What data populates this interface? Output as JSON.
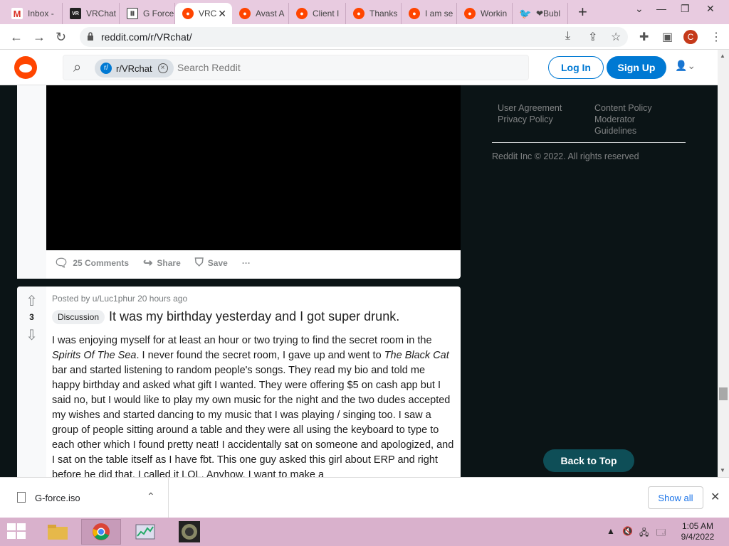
{
  "tabs": [
    {
      "label": "Inbox -",
      "icon": "gmail-icon"
    },
    {
      "label": "VRChat",
      "icon": "vrchat-icon"
    },
    {
      "label": "G Force",
      "icon": "gforce-icon"
    },
    {
      "label": "VRC",
      "icon": "reddit-icon",
      "active": true
    },
    {
      "label": "Avast A",
      "icon": "reddit-icon"
    },
    {
      "label": "Client I",
      "icon": "reddit-icon"
    },
    {
      "label": "Thanks",
      "icon": "reddit-icon"
    },
    {
      "label": "I am se",
      "icon": "reddit-icon"
    },
    {
      "label": "Workin",
      "icon": "reddit-icon"
    },
    {
      "label": "❤Bubl",
      "icon": "twitter-icon"
    }
  ],
  "address_bar": {
    "url": "reddit.com/r/VRchat/",
    "profile_initial": "C"
  },
  "reddit_header": {
    "community_chip": "r/VRchat",
    "search_placeholder": "Search Reddit",
    "login_label": "Log In",
    "signup_label": "Sign Up"
  },
  "post1": {
    "comments_label": "25 Comments",
    "share_label": "Share",
    "save_label": "Save",
    "more_label": "···"
  },
  "post2": {
    "vote_count": "3",
    "posted_by": "Posted by u/Luc1phur 20 hours ago",
    "flair": "Discussion",
    "title": "It was my birthday yesterday and I got super drunk.",
    "body_1": "I was enjoying myself for at least an hour or two trying to find the secret room in the ",
    "body_italic_1": "Spirits Of The Sea",
    "body_2": ". I never found the secret room, I gave up and went to ",
    "body_italic_2": "The Black Cat",
    "body_3": " bar and started listening to random people's songs. They read my bio and told me happy birthday and asked what gift I wanted. They were offering $5 on cash app but I said no, but I would like to play my own music for the night and the two dudes accepted my wishes and started dancing to my music that I was playing / singing too. I saw a group of people sitting around a table and they were all using the keyboard to type to each other which I found pretty neat! I accidentally sat on someone and apologized, and I sat on the table itself as I have fbt. This one guy asked this girl about ERP and right before he did that, I called it LOL. Anyhow, I want to make a"
  },
  "sidebar": {
    "links_col1": [
      "User Agreement",
      "Privacy Policy"
    ],
    "links_col2": [
      "Content Policy",
      "Moderator",
      "Guidelines"
    ],
    "copyright": "Reddit Inc © 2022. All rights reserved",
    "back_to_top": "Back to Top"
  },
  "downloads": {
    "file_name": "G-force.iso",
    "show_all": "Show all"
  },
  "taskbar": {
    "time": "1:05 AM",
    "date": "9/4/2022"
  },
  "colors": {
    "reddit_orange": "#ff4500",
    "reddit_blue": "#0079d3",
    "dark_bg": "#0b1416",
    "back_top_bg": "#0e4e57"
  }
}
